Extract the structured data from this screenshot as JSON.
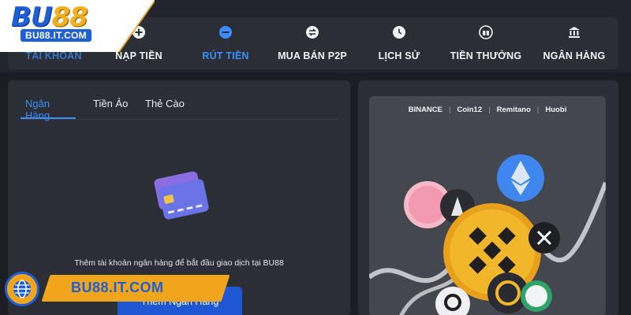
{
  "logo": {
    "text_main": "BU",
    "text_num": "88",
    "url": "BU88.IT.COM"
  },
  "nav": [
    {
      "id": "account",
      "label": "TÀI KHOẢN",
      "icon": "user-icon"
    },
    {
      "id": "deposit",
      "label": "NẠP TIỀN",
      "icon": "plus-circle-icon"
    },
    {
      "id": "withdraw",
      "label": "RÚT TIỀN",
      "icon": "minus-circle-icon"
    },
    {
      "id": "p2p",
      "label": "MUA BÁN P2P",
      "icon": "exchange-icon"
    },
    {
      "id": "history",
      "label": "LỊCH SỬ",
      "icon": "clock-icon"
    },
    {
      "id": "rewards",
      "label": "TIỀN THƯỞNG",
      "icon": "gift-icon"
    },
    {
      "id": "bank",
      "label": "NGÂN HÀNG",
      "icon": "bank-icon"
    }
  ],
  "active_nav": "withdraw",
  "tabs": [
    {
      "label": "Ngân Hàng",
      "active": true
    },
    {
      "label": "Tiền Ảo",
      "active": false
    },
    {
      "label": "Thẻ Cào",
      "active": false
    }
  ],
  "empty_state": {
    "message": "Thêm tài khoản ngân hàng để bắt đầu giao dịch tại BU88",
    "button_label": "Thêm Ngân Hàng"
  },
  "banner": {
    "brands": [
      "BINANCE",
      "Coin12",
      "Remitano",
      "Huobi"
    ]
  },
  "badge": {
    "text": "BU88.IT.COM"
  },
  "colors": {
    "accent": "#3a8eff",
    "brand_blue": "#1f5fd6",
    "brand_gold": "#f0a51c"
  }
}
